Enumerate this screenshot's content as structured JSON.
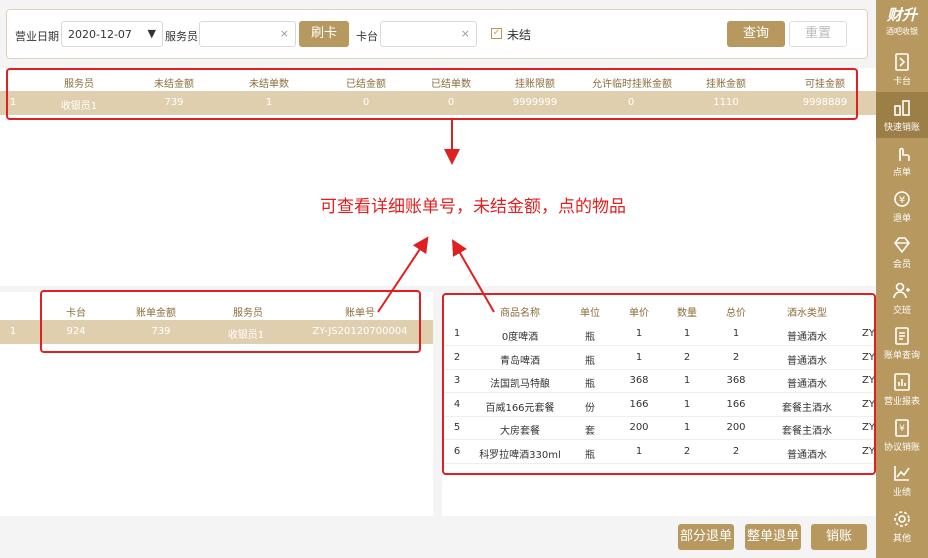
{
  "filter": {
    "date_label": "营业日期",
    "date_value": "2020-12-07",
    "staff_label": "服务员",
    "staff_placeholder": "",
    "swipe_label": "刷卡",
    "card_label": "卡台",
    "card_placeholder": "",
    "unsettled_label": "未结",
    "query_label": "查询",
    "reset_label": "重置"
  },
  "top_table": {
    "headers": [
      "服务员",
      "未结金额",
      "未结单数",
      "已结金额",
      "已结单数",
      "挂账限额",
      "允许临时挂账金额",
      "挂账金额",
      "可挂金额"
    ],
    "rows": [
      {
        "idx": "1",
        "cells": [
          "收银员1",
          "739",
          "1",
          "0",
          "0",
          "9999999",
          "0",
          "1110",
          "9998889"
        ]
      }
    ]
  },
  "annotation": "可查看详细账单号，未结金额，点的物品",
  "left_table": {
    "headers": [
      "卡台",
      "账单金额",
      "服务员",
      "账单号"
    ],
    "rows": [
      {
        "idx": "1",
        "cells": [
          "924",
          "739",
          "收银员1",
          "ZY-JS20120700004"
        ]
      }
    ]
  },
  "right_table": {
    "headers": [
      "商品名称",
      "单位",
      "单价",
      "数量",
      "总价",
      "酒水类型"
    ],
    "rows": [
      {
        "idx": "1",
        "cells": [
          "0度啤酒",
          "瓶",
          "1",
          "1",
          "1",
          "普通酒水"
        ],
        "extra": "ZY"
      },
      {
        "idx": "2",
        "cells": [
          "青岛啤酒",
          "瓶",
          "1",
          "2",
          "2",
          "普通酒水"
        ],
        "extra": "ZY"
      },
      {
        "idx": "3",
        "cells": [
          "法国凯马特酿",
          "瓶",
          "368",
          "1",
          "368",
          "普通酒水"
        ],
        "extra": "ZY"
      },
      {
        "idx": "4",
        "cells": [
          "百威166元套餐",
          "份",
          "166",
          "1",
          "166",
          "套餐主酒水"
        ],
        "extra": "ZY"
      },
      {
        "idx": "5",
        "cells": [
          "大房套餐",
          "套",
          "200",
          "1",
          "200",
          "套餐主酒水"
        ],
        "extra": "ZY"
      },
      {
        "idx": "6",
        "cells": [
          "科罗拉啤酒330ml",
          "瓶",
          "1",
          "2",
          "2",
          "普通酒水"
        ],
        "extra": "ZY"
      }
    ]
  },
  "footer": {
    "partial_refund": "部分退单",
    "full_refund": "整单退单",
    "cancel": "销账"
  },
  "sidebar": {
    "brand": "财升",
    "brand_sub": "酒吧收银",
    "items": [
      {
        "label": "卡台",
        "icon": "table-icon"
      },
      {
        "label": "快速销账",
        "icon": "fast-cancel-icon"
      },
      {
        "label": "点单",
        "icon": "tap-icon"
      },
      {
        "label": "退单",
        "icon": "refund-icon"
      },
      {
        "label": "会员",
        "icon": "diamond-icon"
      },
      {
        "label": "交班",
        "icon": "handover-icon"
      },
      {
        "label": "账单查询",
        "icon": "bill-icon"
      },
      {
        "label": "营业报表",
        "icon": "report-icon"
      },
      {
        "label": "协议销账",
        "icon": "agreement-icon"
      },
      {
        "label": "业绩",
        "icon": "chart-icon"
      },
      {
        "label": "其他",
        "icon": "gear-icon"
      }
    ]
  },
  "colors": {
    "accent": "#b7995f",
    "highlight": "#e0cfae",
    "annotation": "#e02020"
  }
}
